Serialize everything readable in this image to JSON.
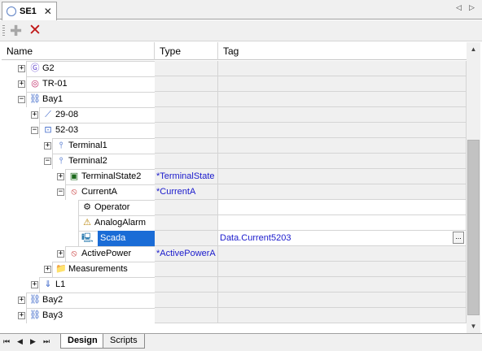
{
  "document_tab": {
    "label": "SE1",
    "close_glyph": "✕"
  },
  "tab_nav": {
    "prev": "◁",
    "next": "▷"
  },
  "toolbar": {
    "add_glyph": "✚",
    "delete_glyph": "✕"
  },
  "columns": {
    "name": "Name",
    "type": "Type",
    "tag": "Tag"
  },
  "rows": [
    {
      "label": "G2",
      "type": "",
      "tag": "",
      "icon": "generator-icon",
      "glyph": "Ⓖ",
      "color": "#6a4fd0"
    },
    {
      "label": "TR-01",
      "type": "",
      "tag": "",
      "icon": "transformer-icon",
      "glyph": "◎",
      "color": "#c22d6a"
    },
    {
      "label": "Bay1",
      "type": "",
      "tag": "",
      "icon": "bay-icon",
      "glyph": "⛓",
      "color": "#3b66c9"
    },
    {
      "label": "29-08",
      "type": "",
      "tag": "",
      "icon": "disconnector-icon",
      "glyph": "⟋",
      "color": "#3b66c9"
    },
    {
      "label": "52-03",
      "type": "",
      "tag": "",
      "icon": "breaker-icon",
      "glyph": "⊡",
      "color": "#3b66c9"
    },
    {
      "label": "Terminal1",
      "type": "",
      "tag": "",
      "icon": "terminal-icon",
      "glyph": "⫯",
      "color": "#3b66c9"
    },
    {
      "label": "Terminal2",
      "type": "",
      "tag": "",
      "icon": "terminal-icon",
      "glyph": "⫯",
      "color": "#3b66c9"
    },
    {
      "label": "TerminalState2",
      "type": "*TerminalState",
      "tag": "",
      "icon": "state-icon",
      "glyph": "▣",
      "color": "#1c6a1c"
    },
    {
      "label": "CurrentA",
      "type": "*CurrentA",
      "tag": "",
      "icon": "measurement-icon",
      "glyph": "⦸",
      "color": "#c83a3a"
    },
    {
      "label": "Operator",
      "type": "",
      "tag": "",
      "icon": "operator-icon",
      "glyph": "⚙",
      "color": "#111111"
    },
    {
      "label": "AnalogAlarm",
      "type": "",
      "tag": "",
      "icon": "alarm-icon",
      "glyph": "⚠",
      "color": "#b8860b"
    },
    {
      "label": "Scada",
      "type": "",
      "tag": "Data.Current5203",
      "icon": "scada-icon",
      "glyph": "🖳",
      "color": "#2b7bb0",
      "ellipsis": "..."
    },
    {
      "label": "ActivePower",
      "type": "*ActivePowerA",
      "tag": "",
      "icon": "measurement-icon",
      "glyph": "⦸",
      "color": "#c83a3a"
    },
    {
      "label": "Measurements",
      "type": "",
      "tag": "",
      "icon": "folder-icon",
      "glyph": "📁",
      "color": "#d4a429"
    },
    {
      "label": "L1",
      "type": "",
      "tag": "",
      "icon": "line-icon",
      "glyph": "⇓",
      "color": "#3b66c9"
    },
    {
      "label": "Bay2",
      "type": "",
      "tag": "",
      "icon": "bay-icon",
      "glyph": "⛓",
      "color": "#3b66c9"
    },
    {
      "label": "Bay3",
      "type": "",
      "tag": "",
      "icon": "bay-icon",
      "glyph": "⛓",
      "color": "#3b66c9"
    }
  ],
  "bottom_tabs": {
    "active": "Design",
    "inactive": "Scripts"
  },
  "bottom_nav": {
    "first": "⏮",
    "prev": "◀",
    "next": "▶",
    "last": "⏭"
  },
  "scrollbar": {
    "up": "▲",
    "down": "▼"
  }
}
